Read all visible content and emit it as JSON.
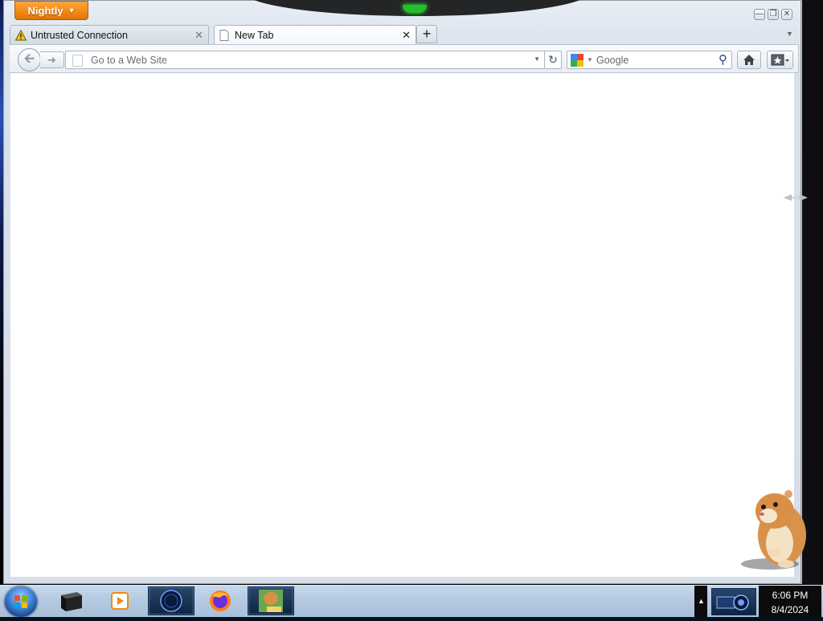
{
  "window": {
    "app_menu_label": "Nightly",
    "controls": [
      "minimize",
      "restore",
      "close"
    ]
  },
  "tabs": [
    {
      "label": "Untrusted Connection",
      "icon": "warning-icon",
      "active": false
    },
    {
      "label": "New Tab",
      "icon": "blank-page-icon",
      "active": true
    }
  ],
  "toolbar": {
    "url_placeholder": "Go to a Web Site",
    "search_engine_icon": "google-logo-icon",
    "search_placeholder": "Google",
    "buttons": [
      "back",
      "forward",
      "reload",
      "home",
      "bookmarks"
    ]
  },
  "taskbar": {
    "items": [
      "start-button",
      "terminal",
      "media-player",
      "globe-app",
      "firefox",
      "hamster-box"
    ],
    "tray_time": "6:06 PM",
    "tray_date": "8/4/2024"
  },
  "colors": {
    "nightly_orange": "#f28a16",
    "warning_yellow": "#f5c518",
    "taskbar_blue": "#b3c9e0"
  }
}
